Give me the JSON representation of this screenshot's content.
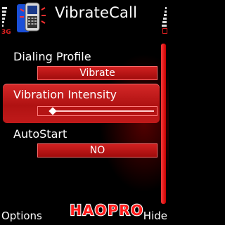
{
  "app": {
    "title": "VibrateCall",
    "network": "3G"
  },
  "settings": [
    {
      "label": "Dialing Profile",
      "value": "Vibrate"
    },
    {
      "label": "Vibration Intensity",
      "level_fraction": 0.05
    },
    {
      "label": "AutoStart",
      "value": "NO"
    }
  ],
  "softkeys": {
    "left": "Options",
    "right": "Hide"
  },
  "watermark": "HAOPRO",
  "colors": {
    "accent": "#d02020",
    "highlight": "#b81616",
    "background": "#000000"
  }
}
